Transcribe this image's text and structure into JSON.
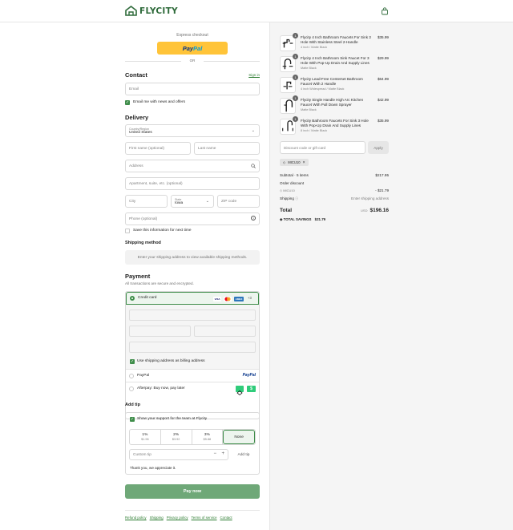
{
  "header": {
    "brand": "FLYCITY",
    "cart_icon": "shopping-bag-icon"
  },
  "express": {
    "title": "Express checkout",
    "paypal_part1": "Pay",
    "paypal_part2": "Pal",
    "or_label": "OR"
  },
  "contact": {
    "heading": "Contact",
    "sign_in": "Sign in",
    "email_placeholder": "Email",
    "news_label": "Email me with news and offers",
    "news_checked": true
  },
  "delivery": {
    "heading": "Delivery",
    "country_label": "Country/Region",
    "country_value": "United States",
    "first_name_placeholder": "First name (optional)",
    "last_name_placeholder": "Last name",
    "address_placeholder": "Address",
    "apartment_placeholder": "Apartment, suite, etc. (optional)",
    "city_placeholder": "City",
    "state_label": "State",
    "state_value": "Iowa",
    "zip_placeholder": "ZIP code",
    "phone_placeholder": "Phone (optional)",
    "save_label": "Save this information for next time",
    "save_checked": false
  },
  "shipping_method": {
    "heading": "Shipping method",
    "message": "Enter your shipping address to view available shipping methods."
  },
  "payment": {
    "heading": "Payment",
    "subtitle": "All transactions are secure and encrypted.",
    "credit_card_label": "Credit card",
    "card_brands": [
      "VISA",
      "MC",
      "AMEX"
    ],
    "more_cards": "+3",
    "billing_label": "Use shipping address as billing address",
    "paypal_label": "PayPal",
    "paypal_logo": "PayPal",
    "afterpay_label": "Afterpay: Buy now, pay later",
    "colors": {
      "accent": "#3f8d4a",
      "afterpay": "#2fcc7a"
    }
  },
  "tip": {
    "heading": "Add tip",
    "show_support_label": "Show your support for the team at Flycity",
    "options": [
      {
        "percent": "1%",
        "amount": "$1.96"
      },
      {
        "percent": "2%",
        "amount": "$3.92"
      },
      {
        "percent": "3%",
        "amount": "$5.88"
      }
    ],
    "none_label": "None",
    "custom_placeholder": "Custom tip",
    "add_button": "Add tip",
    "thanks": "Thank you, we appreciate it."
  },
  "pay_now": "Pay now",
  "footer": {
    "links": [
      "Refund policy",
      "Shipping",
      "Privacy policy",
      "Terms of service",
      "Contact"
    ]
  },
  "order": {
    "items": [
      {
        "name": "Flycity 4 Inch Bathroom Faucets For Sink 3 Hole With Stainless Steel 2-Handle",
        "variant": "4 inch / Matte Black",
        "price": "$35.99",
        "qty": "1"
      },
      {
        "name": "Flycity 4 Inch Bathroom Sink Faucet For 3 Hole With Pop-Up Drain And Supply Lines",
        "variant": "Matte Black",
        "price": "$29.99",
        "qty": "1"
      },
      {
        "name": "Flycity Lead-Free Centerset Bathroom Faucet With 2 Handle",
        "variant": "4 inch Widespread / Matte Black",
        "price": "$64.99",
        "qty": "1"
      },
      {
        "name": "Flycity Single Handle High Arc Kitchen Faucet With Pull Down Sprayer",
        "variant": "Matte Black",
        "price": "$42.99",
        "qty": "1"
      },
      {
        "name": "Flycity Bathroom Faucets For Sink 3 Hole With Pop-Up Drain And Supply Lines",
        "variant": "8 inch / Matte Black",
        "price": "$35.99",
        "qty": "1"
      }
    ],
    "discount_placeholder": "Discount code or gift card",
    "apply_button": "Apply",
    "applied_code": "MICU10",
    "subtotal_label": "Subtotal · 5 items",
    "subtotal_value": "$217.95",
    "order_discount_label": "Order discount",
    "discount_code": "MICU10",
    "discount_value": "- $21.79",
    "shipping_label": "Shipping",
    "shipping_value": "Enter shipping address",
    "total_label": "Total",
    "currency": "USD",
    "total_value": "$196.16",
    "savings_label": "TOTAL SAVINGS",
    "savings_value": "$21.79"
  }
}
